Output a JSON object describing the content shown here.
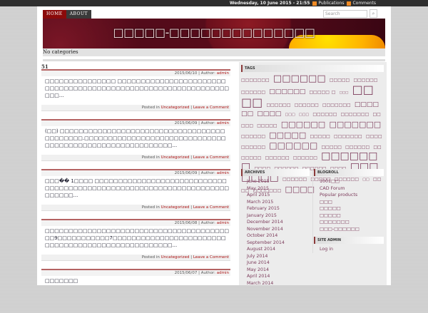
{
  "topbar": {
    "date": "Wednesday, 10 June 2015 - 21:55",
    "publications": "Publications",
    "comments": "Comments"
  },
  "nav": {
    "home": "HOME",
    "about": "ABOUT"
  },
  "search": {
    "placeholder": "Search"
  },
  "header": {
    "title": "□□□□□-□□□□□□□□□□□□□□"
  },
  "categories_bar": "No categories",
  "posts": [
    {
      "title": "51",
      "date": "2015/06/10",
      "author_label": "Author:",
      "author": "admin",
      "body": "□□□□□□□□□□□□□□□ □□□□□□□□□□□□□□□□□□□□□□□□□□□□□□□□□□□□□□□□□□□□□□□□□□□□□□□□□□□□□□□□□...",
      "posted_in": "Posted in",
      "category": "Uncategorized",
      "comment": "Leave a Comment"
    },
    {
      "title": "",
      "date": "2015/06/09",
      "author_label": "Author:",
      "author": "admin",
      "body": "(□□) □□□□□□□□□□□□□□□□□□□□□□□□□□□□□□□□□□□□□□□□□□□.□□□□□□□□□□□□□□□□□□□□□□□□□□□□□□□□□□□□□□□□□□□□□□□□□□□□□□□□□...",
      "posted_in": "Posted in",
      "category": "Uncategorized",
      "comment": "Leave a Comment"
    },
    {
      "title": "",
      "date": "2015/06/09",
      "author_label": "Author:",
      "author": "admin",
      "body": "□□□�� 1□□□□ □□□□□□□□□□□□□□□□□□□□□□□□□□□□□□□□□□□□□□□□□□□□□□□□□□□□□□□□□□□□□□□□□□□□□□□□□...",
      "posted_in": "Posted in",
      "category": "Uncategorized",
      "comment": "Leave a Comment"
    },
    {
      "title": "",
      "date": "2015/06/08",
      "author_label": "Author:",
      "author": "admin",
      "body": "□□□□□□□□□□□□□□□□□□□□□□□□□□□□□□□□□□□□□□□□□9□□□□□□□□□□□7□□□□□□□□□□□□□□□□□□□□□□□□□□□□□□□□□□□□□□□□□□□□□□□□□□□...",
      "posted_in": "Posted in",
      "category": "Uncategorized",
      "comment": "Leave a Comment"
    },
    {
      "title": "",
      "date": "2015/06/07",
      "author_label": "Author:",
      "author": "admin",
      "body": "□□□□□□□"
    }
  ],
  "sidebar": {
    "tags_title": "TAGS",
    "tags": [
      "□□□□□□□",
      "□□□□□□",
      "□□□□□",
      "□□□□□□",
      "□□□□□□",
      "□□□□□□",
      "□□□□□ □",
      "□□□",
      "□□□□",
      "□□□□□□",
      "□□□□□□",
      "□□□□□□□",
      "□□□□□□",
      "□□□□",
      "□□□",
      "□□□",
      "□□□□□□",
      "□□□□□□□",
      "□□□□□",
      "□□□□□",
      "□□□□□□",
      "□□□□□□□",
      "□□□□□□",
      "□□□□□",
      "□□□□□",
      "□□□□□□□",
      "□□□□",
      "□□□□□□",
      "□□□□□□",
      "□□□□□",
      "□□□□□□",
      "□□□□□□□",
      "□□□□□□",
      "□□□□□□",
      "□□□□□□□",
      "□□□□",
      "□□□□□□",
      "□□□□□□",
      "□□□□",
      "□□□□□□□",
      "□□□□□□",
      "□□□□□",
      "□□□□□□",
      "□□",
      "□□□□",
      "□□□□□□□",
      "□□□□"
    ],
    "archives_title": "ARCHIVES",
    "archives": [
      "June 2015",
      "May 2015",
      "April 2015",
      "March 2015",
      "February 2015",
      "January 2015",
      "December 2014",
      "November 2014",
      "October 2014",
      "September 2014",
      "August 2014",
      "July 2014",
      "June 2014",
      "May 2014",
      "April 2014",
      "March 2014"
    ],
    "blogroll_title": "BLOGROLL",
    "blogroll": [
      "1001□□",
      "CAD Forum",
      "Popular products",
      "□□□",
      "□□□□□",
      "□□□□□",
      "□□□□□□□",
      "□□□-□□□□□□"
    ],
    "admin_title": "SITE ADMIN",
    "admin": [
      "Log in"
    ]
  }
}
